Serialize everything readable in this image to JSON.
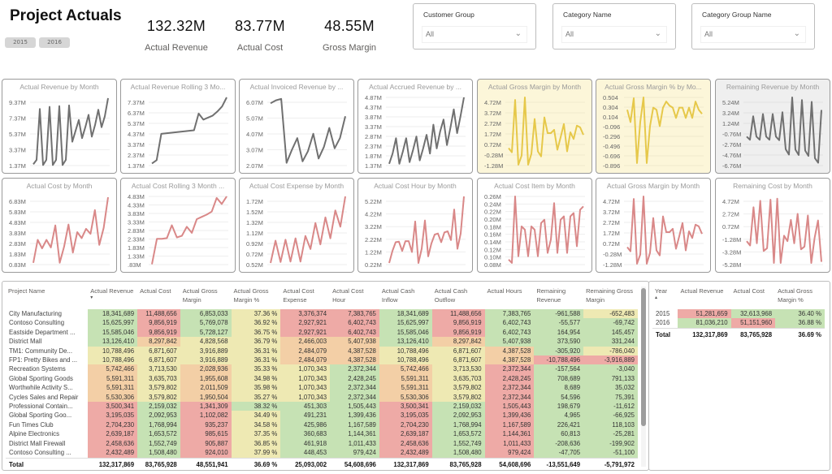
{
  "header": {
    "title": "Project Actuals",
    "year_buttons": [
      "2015",
      "2016"
    ]
  },
  "kpis": [
    {
      "value": "132.32M",
      "label": "Actual Revenue"
    },
    {
      "value": "83.77M",
      "label": "Actual Cost"
    },
    {
      "value": "48.55M",
      "label": "Gross Margin"
    }
  ],
  "slicers": [
    {
      "title": "Customer Group",
      "value": "All"
    },
    {
      "title": "Category Name",
      "value": "All"
    },
    {
      "title": "Category Group Name",
      "value": "All"
    }
  ],
  "colors": {
    "grey_line": "#707070",
    "yellow_line": "#e6c84a",
    "red_line": "#d98888",
    "heat_green": "#c3e0b0",
    "heat_yellow": "#f2ecb0",
    "heat_red": "#eeaaa6"
  },
  "chart_data": [
    {
      "type": "line",
      "title": "Actual Revenue by Month",
      "color": "grey",
      "bg": "white",
      "yticks": [
        "9.37M",
        "7.37M",
        "5.37M",
        "3.37M",
        "1.37M"
      ],
      "ylim": [
        1.0,
        10.6
      ],
      "values": [
        1.4,
        2.0,
        9.0,
        1.3,
        2.0,
        9.3,
        1.3,
        2.0,
        9.4,
        1.3,
        2.0,
        9.5,
        4.5,
        6.0,
        7.5,
        5.0,
        6.5,
        8.2,
        5.2,
        6.8,
        8.9,
        6.5,
        8.0,
        10.5
      ]
    },
    {
      "type": "line",
      "title": "Actual Revenue Rolling  3 Mo...",
      "color": "grey",
      "bg": "white",
      "yticks": [
        "7.37M",
        "6.37M",
        "5.37M",
        "4.37M",
        "3.37M",
        "2.37M",
        "1.37M"
      ],
      "ylim": [
        1.0,
        7.9
      ],
      "values": [
        1.37,
        1.7,
        4.3,
        4.35,
        4.4,
        4.45,
        4.5,
        4.55,
        4.6,
        4.65,
        6.3,
        5.7,
        5.9,
        6.1,
        6.5,
        7.0,
        7.9
      ]
    },
    {
      "type": "line",
      "title": "Actual Invoiced Revenue by ...",
      "color": "grey",
      "bg": "white",
      "yticks": [
        "6.07M",
        "5.07M",
        "4.07M",
        "3.07M",
        "2.07M"
      ],
      "ylim": [
        1.8,
        6.6
      ],
      "values": [
        6.2,
        6.4,
        6.5,
        2.1,
        3.0,
        3.8,
        2.2,
        2.9,
        4.1,
        2.4,
        3.2,
        4.5,
        3.1,
        3.8,
        5.3
      ]
    },
    {
      "type": "line",
      "title": "Actual Accrued Revenue by ...",
      "color": "grey",
      "bg": "white",
      "yticks": [
        "4.87M",
        "4.37M",
        "3.87M",
        "3.37M",
        "2.87M",
        "2.37M",
        "1.87M",
        "1.37M"
      ],
      "ylim": [
        1.2,
        5.3
      ],
      "values": [
        1.4,
        2.0,
        2.9,
        1.4,
        2.1,
        2.9,
        1.5,
        2.2,
        3.0,
        1.6,
        2.3,
        3.1,
        2.0,
        3.7,
        2.3,
        3.3,
        4.0,
        2.5,
        3.5,
        4.6,
        3.2,
        4.2,
        5.3
      ]
    },
    {
      "type": "line",
      "title": "Actual Gross Margin by Month",
      "color": "yellow",
      "bg": "yellow",
      "yticks": [
        "4.72M",
        "3.72M",
        "2.72M",
        "1.72M",
        "0.72M",
        "-0.28M",
        "-1.28M"
      ],
      "ylim": [
        -1.6,
        6.8
      ],
      "values": [
        0.7,
        0.2,
        6.5,
        -1.3,
        -0.2,
        6.8,
        -1.3,
        0.0,
        4.2,
        0.3,
        -0.3,
        4.4,
        2.5,
        2.5,
        2.9,
        0.5,
        2.0,
        3.6,
        0.3,
        2.6,
        1.8,
        3.4,
        3.2,
        2.3
      ]
    },
    {
      "type": "line",
      "title": "Actual Gross Margin % by Mo...",
      "color": "yellow",
      "bg": "yellow",
      "yticks": [
        "0.504",
        "0.304",
        "0.104",
        "-0.096",
        "-0.296",
        "-0.496",
        "-0.696",
        "-0.896"
      ],
      "ylim": [
        -1.0,
        0.7
      ],
      "values": [
        0.4,
        0.1,
        0.68,
        -0.9,
        0.1,
        0.7,
        -0.9,
        0.0,
        0.45,
        0.4,
        0.0,
        0.45,
        0.6,
        0.5,
        0.45,
        0.2,
        0.45,
        0.45,
        0.2,
        0.45,
        0.2,
        0.6,
        0.4,
        0.3
      ]
    },
    {
      "type": "line",
      "title": "Remaining Revenue by Month",
      "color": "grey",
      "bg": "grey",
      "yticks": [
        "5.24M",
        "3.24M",
        "1.24M",
        "-0.76M",
        "-2.76M",
        "-4.76M",
        "-6.76M"
      ],
      "ylim": [
        -7.5,
        8.0
      ],
      "values": [
        -0.7,
        -1.4,
        3.8,
        -0.7,
        -1.4,
        4.3,
        -0.7,
        -1.4,
        4.3,
        -0.7,
        -1.5,
        4.7,
        -3.5,
        -4.7,
        8.0,
        -3.6,
        -4.8,
        7.4,
        -3.8,
        -5.0,
        7.0,
        -5.5,
        -6.5,
        5.2
      ]
    },
    {
      "type": "line",
      "title": "Actual Cost by Month",
      "color": "red",
      "bg": "white",
      "yticks": [
        "6.83M",
        "5.83M",
        "4.83M",
        "3.83M",
        "2.83M",
        "1.83M",
        "0.83M"
      ],
      "ylim": [
        0.5,
        8.7
      ],
      "values": [
        0.9,
        3.6,
        2.6,
        3.6,
        2.7,
        5.3,
        0.9,
        2.8,
        5.4,
        2.1,
        4.5,
        3.8,
        4.9,
        4.3,
        7.1,
        3.0,
        5.0,
        8.6
      ]
    },
    {
      "type": "line",
      "title": "Actual Cost Rolling  3 Month ...",
      "color": "red",
      "bg": "white",
      "yticks": [
        "4.83M",
        "4.33M",
        "3.83M",
        "3.33M",
        "2.83M",
        "2.33M",
        "1.83M",
        "1.33M",
        ".83M"
      ],
      "ylim": [
        0.7,
        5.3
      ],
      "values": [
        0.83,
        2.5,
        2.5,
        2.55,
        3.4,
        2.6,
        2.7,
        3.3,
        2.9,
        3.8,
        3.95,
        4.1,
        4.3,
        5.2,
        4.8,
        5.3
      ]
    },
    {
      "type": "line",
      "title": "Actual Cost Expense by Month",
      "color": "red",
      "bg": "white",
      "yticks": [
        "1.72M",
        "1.52M",
        "1.32M",
        "1.12M",
        "0.92M",
        "0.72M",
        "0.52M"
      ],
      "ylim": [
        0.45,
        1.95
      ],
      "values": [
        0.52,
        1.0,
        0.54,
        1.02,
        0.55,
        1.05,
        0.55,
        1.1,
        0.82,
        1.38,
        0.92,
        1.5,
        1.05,
        1.65,
        1.3,
        1.95
      ]
    },
    {
      "type": "line",
      "title": "Actual Cost Hour by Month",
      "color": "red",
      "bg": "white",
      "yticks": [
        "5.22M",
        "4.22M",
        "3.22M",
        "2.22M",
        "1.22M",
        "0.22M"
      ],
      "ylim": [
        0.0,
        6.4
      ],
      "values": [
        0.3,
        1.4,
        2.2,
        2.25,
        1.4,
        2.3,
        2.3,
        1.3,
        4.1,
        0.3,
        1.6,
        4.2,
        0.9,
        2.1,
        2.9,
        3.0,
        2.2,
        3.1,
        3.2,
        2.4,
        5.2,
        1.6,
        3.0,
        6.4
      ]
    },
    {
      "type": "line",
      "title": "Actual Cost Item by Month",
      "color": "red",
      "bg": "white",
      "yticks": [
        "0.26M",
        "0.24M",
        "0.22M",
        "0.20M",
        "0.18M",
        "0.16M",
        "0.14M",
        "0.12M",
        "0.10M",
        "0.08M"
      ],
      "ylim": [
        0.07,
        0.28
      ],
      "values": [
        0.09,
        0.08,
        0.28,
        0.1,
        0.19,
        0.18,
        0.1,
        0.19,
        0.18,
        0.1,
        0.2,
        0.21,
        0.11,
        0.15,
        0.26,
        0.11,
        0.21,
        0.22,
        0.11,
        0.22,
        0.23,
        0.13,
        0.24,
        0.25
      ]
    },
    {
      "type": "line",
      "title": "Actual Gross Margin by Month",
      "color": "red",
      "bg": "white",
      "yticks": [
        "4.72M",
        "3.72M",
        "2.72M",
        "1.72M",
        "0.72M",
        "-0.28M",
        "-1.28M"
      ],
      "ylim": [
        -1.6,
        6.8
      ],
      "values": [
        0.7,
        0.2,
        6.5,
        -1.3,
        -0.2,
        6.8,
        -1.3,
        0.0,
        4.2,
        0.3,
        -0.3,
        4.4,
        2.5,
        2.5,
        2.9,
        0.5,
        2.0,
        3.6,
        0.3,
        2.6,
        1.8,
        3.4,
        3.2,
        2.3
      ]
    },
    {
      "type": "line",
      "title": "Remaining Cost by Month",
      "color": "red",
      "bg": "white",
      "yticks": [
        "4.72M",
        "2.72M",
        "0.72M",
        "-1.28M",
        "-3.28M",
        "-5.28M"
      ],
      "ylim": [
        -5.8,
        7.0
      ],
      "values": [
        -1.2,
        -2.0,
        5.0,
        -1.6,
        6.2,
        -3.0,
        -2.5,
        6.4,
        -5.2,
        6.6,
        -5.2,
        -0.2,
        -1.2,
        2.7,
        -1.6,
        3.8,
        -2.7,
        -2.2,
        3.5,
        -5.2,
        -0.6,
        2.6,
        -5.0
      ]
    }
  ],
  "project_table": {
    "columns": [
      "Project Name",
      "Actual Revenue",
      "Actual Cost",
      "Actual Gross Margin",
      "Actual Gross Margin %",
      "Actual Cost Expense",
      "Actual Cost Hour",
      "Actual Cash Inflow",
      "Actual Cash Outflow",
      "Actual Hours",
      "Remaining Revenue",
      "Remaining Gross Margin"
    ],
    "sort_column": "Actual Revenue",
    "rows": [
      [
        "City Manufacturing",
        "18,341,689",
        "11,488,656",
        "6,853,033",
        "37.36 %",
        "3,376,374",
        "7,383,765",
        "18,341,689",
        "11,488,656",
        "7,383,765",
        "-961,588",
        "-652,483"
      ],
      [
        "Contoso Consulting",
        "15,625,997",
        "9,856,919",
        "5,769,078",
        "36.92 %",
        "2,927,921",
        "6,402,743",
        "15,625,997",
        "9,856,919",
        "6,402,743",
        "-55,577",
        "-69,742"
      ],
      [
        "Eastside Department ...",
        "15,585,046",
        "9,856,919",
        "5,728,127",
        "36.75 %",
        "2,927,921",
        "6,402,743",
        "15,585,046",
        "9,856,919",
        "6,402,743",
        "164,954",
        "145,457"
      ],
      [
        "District Mall",
        "13,126,410",
        "8,297,842",
        "4,828,568",
        "36.79 %",
        "2,466,003",
        "5,407,938",
        "13,126,410",
        "8,297,842",
        "5,407,938",
        "373,590",
        "331,244"
      ],
      [
        "TM1: Community De...",
        "10,788,496",
        "6,871,607",
        "3,916,889",
        "36.31 %",
        "2,484,079",
        "4,387,528",
        "10,788,496",
        "6,871,607",
        "4,387,528",
        "-305,920",
        "-786,040"
      ],
      [
        "FP1: Pretty Bikes and ...",
        "10,788,496",
        "6,871,607",
        "3,916,889",
        "36.31 %",
        "2,484,079",
        "4,387,528",
        "10,788,496",
        "6,871,607",
        "4,387,528",
        "-10,788,496",
        "-3,916,889"
      ],
      [
        "Recreation Systems",
        "5,742,466",
        "3,713,530",
        "2,028,936",
        "35.33 %",
        "1,070,343",
        "2,372,344",
        "5,742,466",
        "3,713,530",
        "2,372,344",
        "-157,564",
        "-3,040"
      ],
      [
        "Global Sporting Goods",
        "5,591,311",
        "3,635,703",
        "1,955,608",
        "34.98 %",
        "1,070,343",
        "2,428,245",
        "5,591,311",
        "3,635,703",
        "2,428,245",
        "708,689",
        "791,133"
      ],
      [
        "Worthwhile Activity S...",
        "5,591,311",
        "3,579,802",
        "2,011,509",
        "35.98 %",
        "1,070,343",
        "2,372,344",
        "5,591,311",
        "3,579,802",
        "2,372,344",
        "8,689",
        "35,032"
      ],
      [
        "Cycles Sales and Repair",
        "5,530,306",
        "3,579,802",
        "1,950,504",
        "35.27 %",
        "1,070,343",
        "2,372,344",
        "5,530,306",
        "3,579,802",
        "2,372,344",
        "54,596",
        "75,391"
      ],
      [
        "Professional Contain...",
        "3,500,341",
        "2,159,032",
        "1,341,309",
        "38.32 %",
        "451,303",
        "1,505,443",
        "3,500,341",
        "2,159,032",
        "1,505,443",
        "198,679",
        "-11,612"
      ],
      [
        "Global Sporting Goo...",
        "3,195,035",
        "2,092,953",
        "1,102,082",
        "34.49 %",
        "491,231",
        "1,399,436",
        "3,195,035",
        "2,092,953",
        "1,399,436",
        "4,965",
        "-66,925"
      ],
      [
        "Fun Times Club",
        "2,704,230",
        "1,768,994",
        "935,237",
        "34.58 %",
        "425,986",
        "1,167,589",
        "2,704,230",
        "1,768,994",
        "1,167,589",
        "226,421",
        "118,103"
      ],
      [
        "Alpine Electronics",
        "2,639,187",
        "1,653,572",
        "985,615",
        "37.35 %",
        "360,683",
        "1,144,361",
        "2,639,187",
        "1,653,572",
        "1,144,361",
        "60,813",
        "-25,281"
      ],
      [
        "District Mall Firewall",
        "2,458,636",
        "1,552,749",
        "905,887",
        "36.85 %",
        "461,918",
        "1,011,433",
        "2,458,636",
        "1,552,749",
        "1,011,433",
        "-208,636",
        "-199,902"
      ],
      [
        "Contoso Consulting ...",
        "2,432,489",
        "1,508,480",
        "924,010",
        "37.99 %",
        "448,453",
        "979,424",
        "2,432,489",
        "1,508,480",
        "979,424",
        "-47,705",
        "-51,100"
      ]
    ],
    "heat": [
      [
        "g",
        "r",
        "g",
        "y",
        "r",
        "r",
        "g",
        "r",
        "g",
        "g",
        "y"
      ],
      [
        "g",
        "r",
        "g",
        "y",
        "r",
        "r",
        "g",
        "r",
        "g",
        "g",
        "g"
      ],
      [
        "g",
        "r",
        "g",
        "y",
        "r",
        "r",
        "g",
        "r",
        "g",
        "g",
        "g"
      ],
      [
        "g",
        "o",
        "y",
        "y",
        "o",
        "o",
        "g",
        "o",
        "g",
        "g",
        "g"
      ],
      [
        "y",
        "y",
        "y",
        "y",
        "o",
        "o",
        "y",
        "y",
        "o",
        "g",
        "y"
      ],
      [
        "y",
        "y",
        "y",
        "y",
        "o",
        "o",
        "y",
        "y",
        "o",
        "r",
        "r"
      ],
      [
        "o",
        "y",
        "o",
        "y",
        "y",
        "g",
        "o",
        "y",
        "r",
        "g",
        "g"
      ],
      [
        "o",
        "y",
        "o",
        "y",
        "y",
        "g",
        "o",
        "y",
        "r",
        "g",
        "g"
      ],
      [
        "o",
        "y",
        "o",
        "y",
        "y",
        "g",
        "o",
        "y",
        "r",
        "g",
        "g"
      ],
      [
        "o",
        "y",
        "o",
        "y",
        "y",
        "g",
        "o",
        "y",
        "r",
        "g",
        "g"
      ],
      [
        "r",
        "g",
        "r",
        "g",
        "g",
        "g",
        "r",
        "g",
        "r",
        "g",
        "g"
      ],
      [
        "r",
        "g",
        "r",
        "y",
        "g",
        "g",
        "r",
        "g",
        "r",
        "g",
        "g"
      ],
      [
        "r",
        "g",
        "r",
        "y",
        "g",
        "g",
        "r",
        "g",
        "r",
        "g",
        "g"
      ],
      [
        "r",
        "g",
        "r",
        "y",
        "g",
        "g",
        "r",
        "g",
        "r",
        "g",
        "g"
      ],
      [
        "r",
        "g",
        "r",
        "y",
        "g",
        "g",
        "r",
        "g",
        "r",
        "g",
        "g"
      ],
      [
        "r",
        "g",
        "r",
        "y",
        "g",
        "g",
        "r",
        "g",
        "r",
        "g",
        "g"
      ]
    ],
    "total": [
      "Total",
      "132,317,869",
      "83,765,928",
      "48,551,941",
      "36.69 %",
      "25,093,002",
      "54,608,696",
      "132,317,869",
      "83,765,928",
      "54,608,696",
      "-13,551,649",
      "-5,791,972"
    ]
  },
  "year_table": {
    "columns": [
      "Year",
      "Actual Revenue",
      "Actual Cost",
      "Actual Gross Margin %"
    ],
    "sort_column": "Year",
    "rows": [
      [
        "2015",
        "51,281,659",
        "32,613,968",
        "36.40 %"
      ],
      [
        "2016",
        "81,036,210",
        "51,151,960",
        "36.88 %"
      ]
    ],
    "heat": [
      [
        "r",
        "g",
        "g"
      ],
      [
        "g",
        "r",
        "g"
      ]
    ],
    "total": [
      "Total",
      "132,317,869",
      "83,765,928",
      "36.69 %"
    ]
  }
}
